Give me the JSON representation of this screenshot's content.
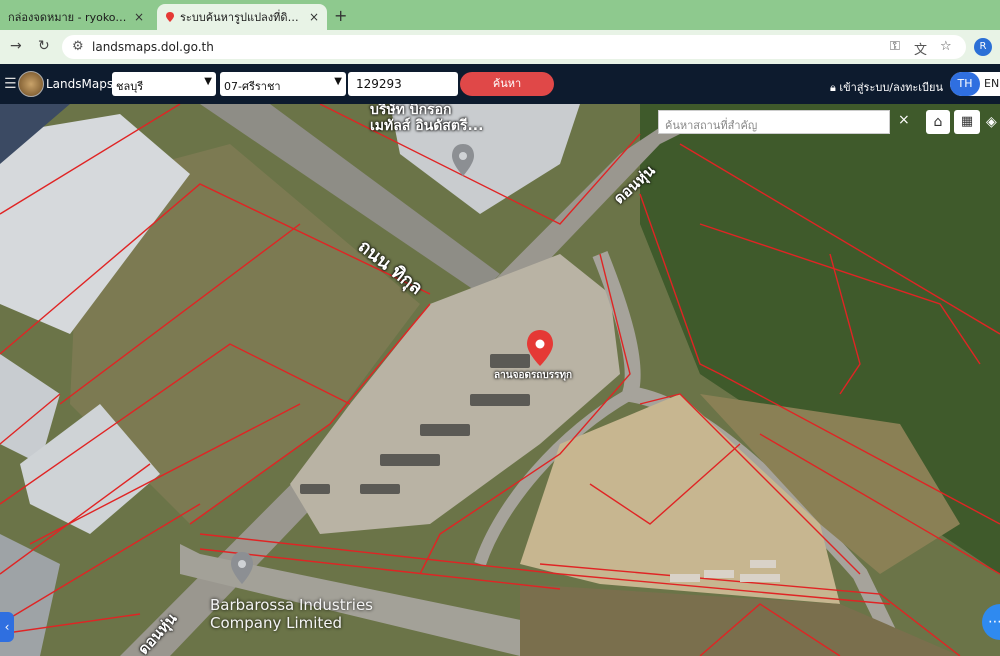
{
  "browser": {
    "tabs": [
      {
        "label": "กล่องจดหมาย - ryoko.transpo",
        "active": false
      },
      {
        "label": "ระบบค้นหารูปแปลงที่ดิน (Landsl",
        "active": true
      }
    ],
    "new_tab": "+",
    "close": "×",
    "url": "landsmaps.dol.go.th",
    "profile_initial": "R"
  },
  "app": {
    "brand": "LandsMaps",
    "province": "ชลบุรี",
    "district": "07-ศรีราชา",
    "parcel_number": "129293",
    "search_button": "ค้นหา",
    "login": "เข้าสู่ระบบ/ลงทะเบียน",
    "lang_th": "TH",
    "lang_en": "EN"
  },
  "map": {
    "place_search_placeholder": "ค้นหาสถานที่สำคัญ",
    "close": "×",
    "labels": {
      "company_top_line1": "บริษัท บิ๊กรอก",
      "company_top_line2": "เมทัลส์ อินดัสตรี...",
      "road_thikul": "ถนน ทิกุล",
      "road_donhun_top": "ดอนหุ่น",
      "road_donhun_bottom": "ดอนหุ่น",
      "marker_label": "ลานจอดรถบรรทุก",
      "company_bottom_line1": "Barbarossa Industries",
      "company_bottom_line2": "Company Limited"
    },
    "colors": {
      "parcel_lines": "#e02424",
      "marker": "#e53935",
      "accent_blue": "#2f6fe0",
      "header_bg": "#0d1b2e",
      "search_red": "#e04848"
    }
  }
}
